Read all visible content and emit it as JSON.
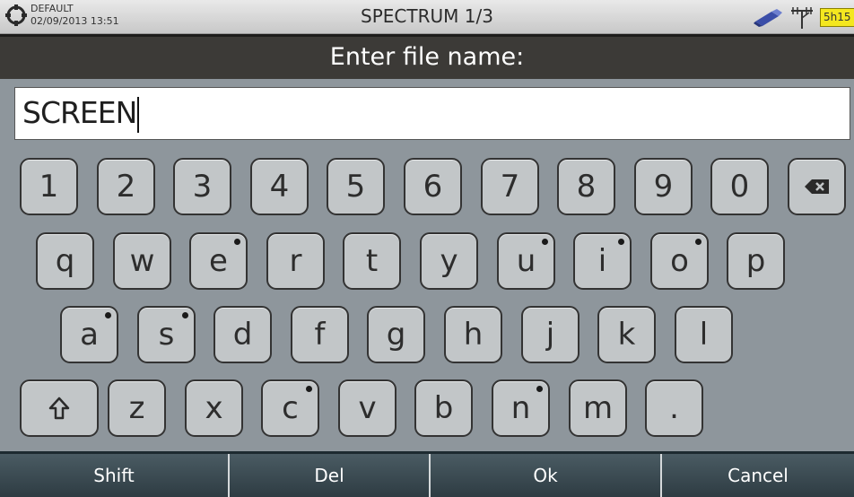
{
  "status": {
    "profile_icon": "profile-ring-icon",
    "profile": "DEFAULT",
    "datetime": "02/09/2013 13:51",
    "title": "SPECTRUM 1/3",
    "battery": "5h15",
    "battery_color": "#f4e71f"
  },
  "dialog": {
    "title": "Enter file name:",
    "filename": "SCREEN"
  },
  "keyboard": {
    "row1": [
      "1",
      "2",
      "3",
      "4",
      "5",
      "6",
      "7",
      "8",
      "9",
      "0"
    ],
    "row2": [
      "q",
      "w",
      "e",
      "r",
      "t",
      "y",
      "u",
      "i",
      "o",
      "p"
    ],
    "row3": [
      "a",
      "s",
      "d",
      "f",
      "g",
      "h",
      "j",
      "k",
      "l"
    ],
    "row4": [
      "z",
      "x",
      "c",
      "v",
      "b",
      "n",
      "m",
      "."
    ],
    "backspace_icon": "backspace-icon",
    "shift_icon": "shift-arrow-icon"
  },
  "softkeys": {
    "shift": "Shift",
    "del": "Del",
    "ok": "Ok",
    "cancel": "Cancel"
  }
}
